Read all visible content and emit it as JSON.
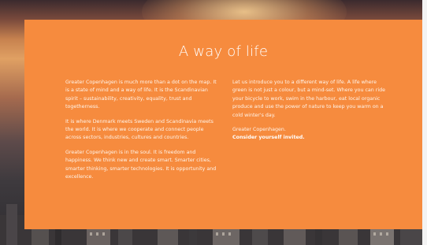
{
  "section": {
    "title": "A way of life",
    "left_column": [
      "Greater Copenhagen is much more than a dot on the map. It is a state of mind and a way of life. It is the Scandinavian spirit – sustainability, creativity, equality, trust and togetherness.",
      "It is where Denmark meets Sweden and Scandinavia meets the world. It is where we cooperate and connect people across sectors, industries, cultures and countries.",
      "Greater Copenhagen is in the soul. It is freedom and happiness. We think new and create smart. Smarter cities, smarter thinking, smarter technologies. It is opportunity and excellence."
    ],
    "right_column": [
      "Let us introduce you to a different way of life. A life where green is not just a colour, but a mind-set. Where you can ride your bicycle to work, swim in the harbour, eat local organic produce and use the power of nature to keep you warm on a cold winter's day.",
      "Greater Copenhagen.",
      "Consider yourself invited."
    ]
  },
  "colors": {
    "panel": "#f68b3e",
    "text": "#ffffff"
  }
}
